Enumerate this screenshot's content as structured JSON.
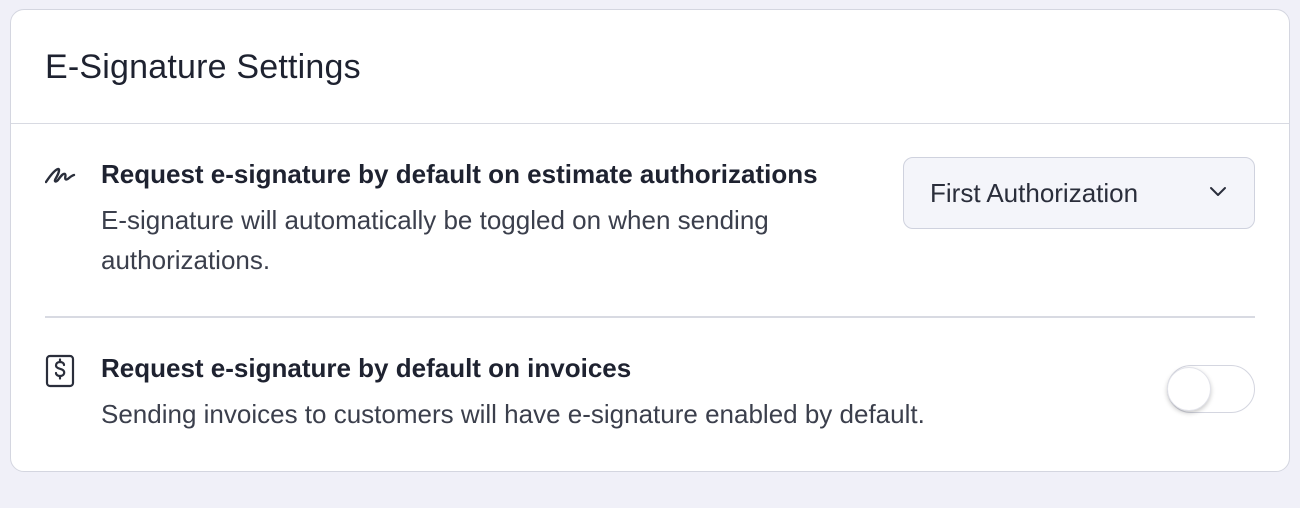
{
  "card": {
    "title": "E-Signature Settings"
  },
  "settings": [
    {
      "icon": "signature-icon",
      "title": "Request e-signature by default on estimate authorizations",
      "description": "E-signature will automatically be toggled on when sending authorizations.",
      "control": "select",
      "selected": "First Authorization"
    },
    {
      "icon": "invoice-dollar-icon",
      "title": "Request e-signature by default on invoices",
      "description": "Sending invoices to customers will have e-signature enabled by default.",
      "control": "toggle",
      "enabled": false
    }
  ],
  "colors": {
    "page_background": "#f0f0f8",
    "card_background": "#ffffff",
    "border": "#d4d6e0",
    "text": "#1e2230"
  }
}
